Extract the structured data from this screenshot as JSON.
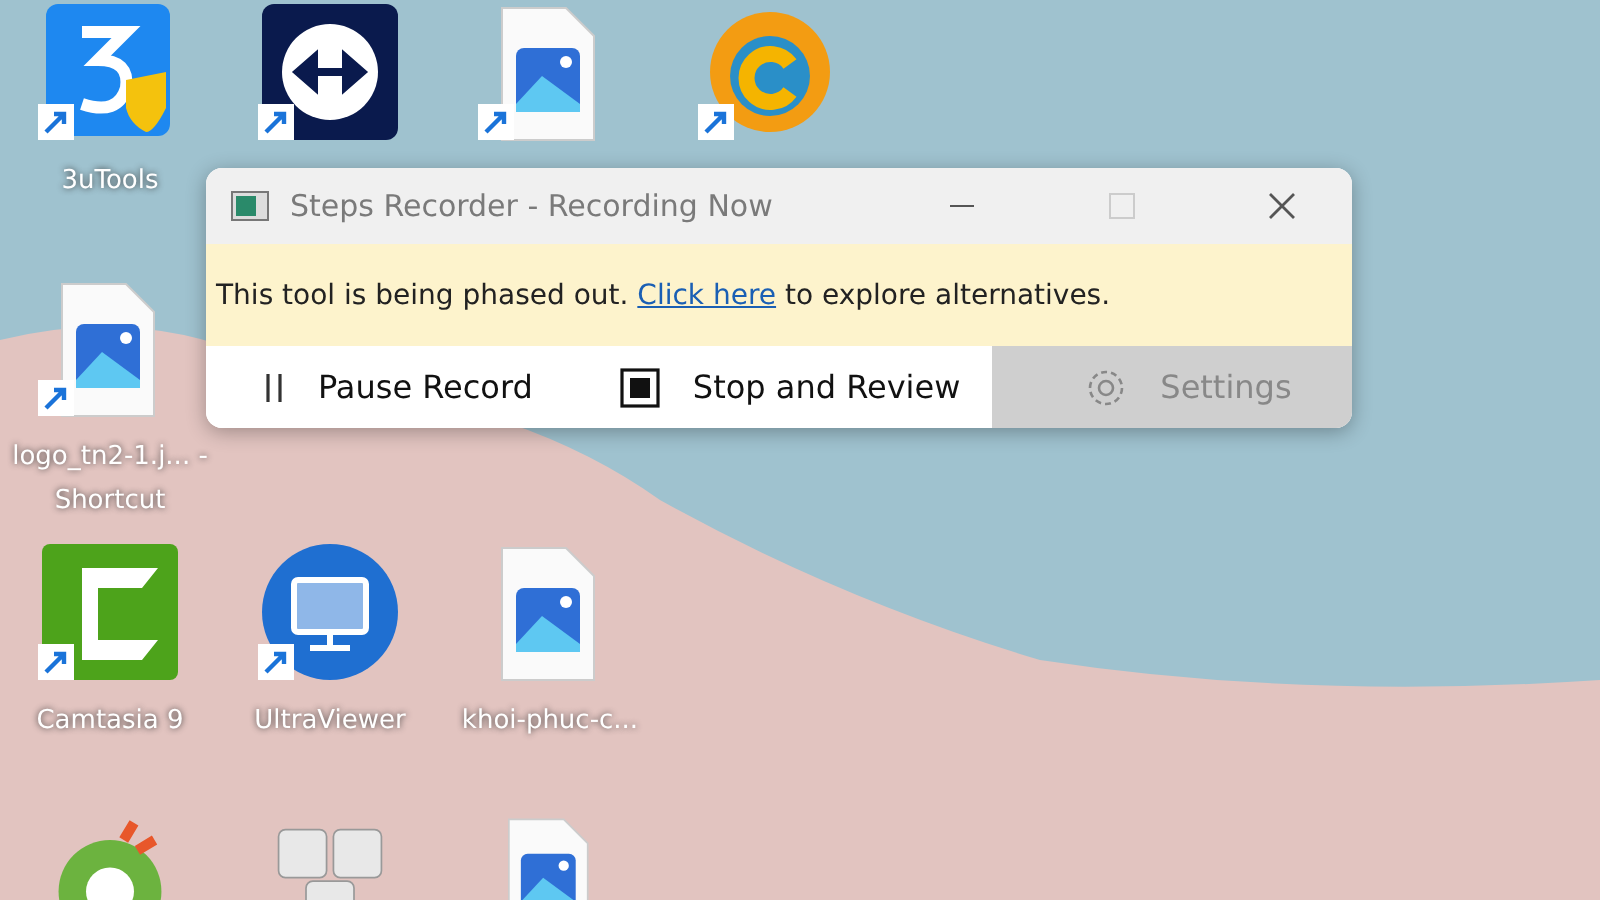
{
  "desktop": {
    "rows": [
      [
        {
          "kind": "blue-app",
          "label": "3uTools",
          "shortcut": true
        },
        {
          "kind": "remote-app",
          "shortcut": true
        },
        {
          "kind": "image-file",
          "shortcut": true
        },
        {
          "kind": "converter-app",
          "shortcut": true
        }
      ],
      [
        {
          "kind": "image-file",
          "label": "logo_tn2-1.j... - Shortcut",
          "shortcut": true
        }
      ],
      [
        {
          "kind": "green-app",
          "label": "Camtasia 9",
          "shortcut": true
        },
        {
          "kind": "monitor-app",
          "label": "UltraViewer",
          "shortcut": true
        },
        {
          "kind": "image-file",
          "label": "khoi-phuc-c...",
          "shortcut": false
        }
      ],
      [
        {
          "kind": "browser-app"
        },
        {
          "kind": "keys-app"
        },
        {
          "kind": "image-file"
        }
      ]
    ]
  },
  "window": {
    "title": "Steps Recorder - Recording Now",
    "banner": {
      "before": "This tool is being phased out.",
      "link": "Click here",
      "after": "to explore alternatives."
    },
    "buttons": [
      {
        "kind": "pause",
        "label": "Pause Record",
        "disabled": false
      },
      {
        "kind": "stop",
        "label": "Stop and Review",
        "disabled": false
      },
      {
        "kind": "settings",
        "label": "Settings",
        "disabled": true
      }
    ]
  }
}
